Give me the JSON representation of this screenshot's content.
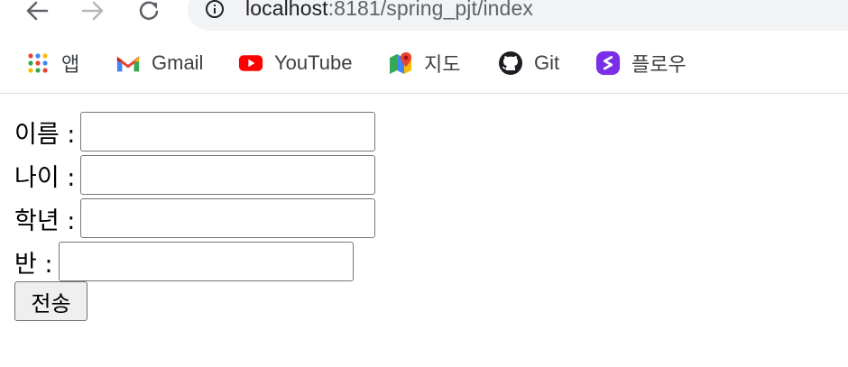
{
  "browser": {
    "url_host": "localhost",
    "url_rest": ":8181/spring_pjt/index"
  },
  "bookmarks": [
    {
      "label": "앱",
      "icon": "apps-grid-icon"
    },
    {
      "label": "Gmail",
      "icon": "gmail-icon"
    },
    {
      "label": "YouTube",
      "icon": "youtube-icon"
    },
    {
      "label": "지도",
      "icon": "maps-icon"
    },
    {
      "label": "Git",
      "icon": "github-icon"
    },
    {
      "label": "플로우",
      "icon": "flow-icon"
    }
  ],
  "form": {
    "name_label": "이름 :",
    "age_label": "나이 :",
    "grade_label": "학년 :",
    "class_label": "반 :",
    "name_value": "",
    "age_value": "",
    "grade_value": "",
    "class_value": "",
    "submit_label": "전송"
  }
}
